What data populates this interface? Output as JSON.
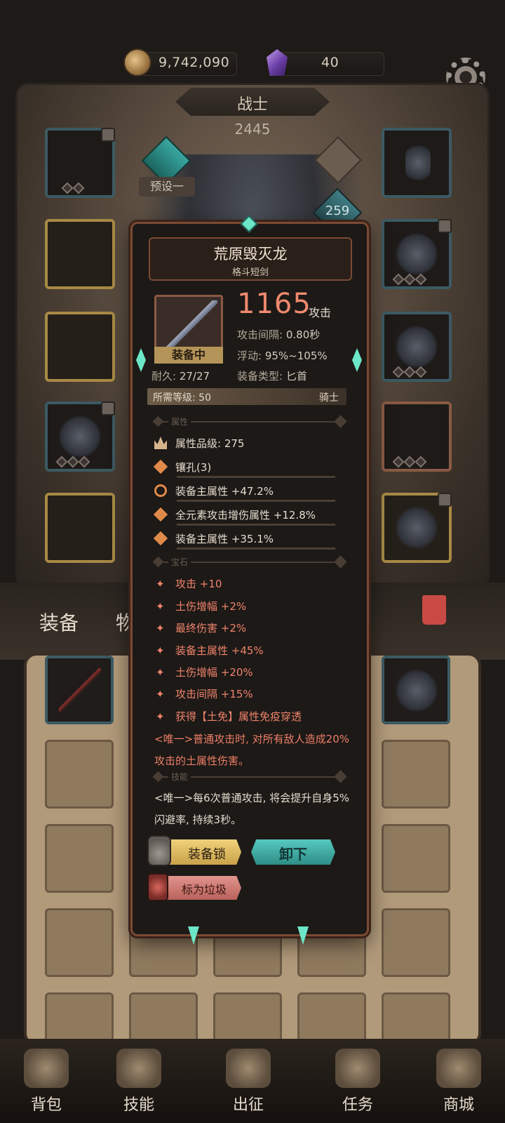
{
  "currency": {
    "gold_icon": "gold-coin-icon",
    "gold": "9,742,090",
    "gem_icon": "purple-gem-icon",
    "gems": "40"
  },
  "header": {
    "class_name": "战士",
    "power": "2445",
    "preset": "预设一",
    "level": "259"
  },
  "inventory": {
    "tabs": [
      "装备",
      "物品"
    ]
  },
  "item": {
    "name": "荒原毁灭龙",
    "type": "格斗短剑",
    "attack": "1165",
    "attack_unit": "攻击",
    "equipped_label": "装备中",
    "durability_label": "耐久:",
    "durability": "27/27",
    "stats": [
      {
        "label": "攻击间隔:",
        "value": "0.80秒"
      },
      {
        "label": "浮动:",
        "value": "95%~105%"
      },
      {
        "label": "装备类型:",
        "value": "匕首"
      }
    ],
    "requirement_label": "所需等级:",
    "requirement_level": "50",
    "requirement_class": "骑士",
    "sections": {
      "attributes": "属性",
      "gems": "宝石",
      "skills": "技能"
    },
    "attributes": [
      "属性品级: 275",
      "镶孔(3)",
      "装备主属性 +47.2%",
      "全元素攻击增伤属性 +12.8%",
      "装备主属性 +35.1%"
    ],
    "gem_stats": [
      "攻击 +10",
      "土伤增幅 +2%",
      "最终伤害 +2%",
      "装备主属性 +45%",
      "土伤增幅 +20%",
      "攻击间隔 +15%",
      "获得【土免】属性免疫穿透"
    ],
    "unique_effect": "<唯一>普通攻击时, 对所有敌人造成20%攻击的土属性伤害。",
    "skill_effect": "<唯一>每6次普通攻击, 将会提升自身5%闪避率, 持续3秒。",
    "buttons": {
      "lock": "装备锁",
      "unequip": "卸下",
      "junk": "标为垃圾"
    }
  },
  "nav": [
    {
      "label": "背包",
      "icon": "backpack-icon"
    },
    {
      "label": "技能",
      "icon": "skill-book-icon"
    },
    {
      "label": "出征",
      "icon": "battle-sword-icon"
    },
    {
      "label": "任务",
      "icon": "quest-scroll-icon"
    },
    {
      "label": "商城",
      "icon": "shop-icon"
    }
  ],
  "colors": {
    "attack": "#f08a6e",
    "gem_stat": "#f0836a",
    "accent_teal": "#57c9c0",
    "accent_gold": "#c9a24a"
  }
}
